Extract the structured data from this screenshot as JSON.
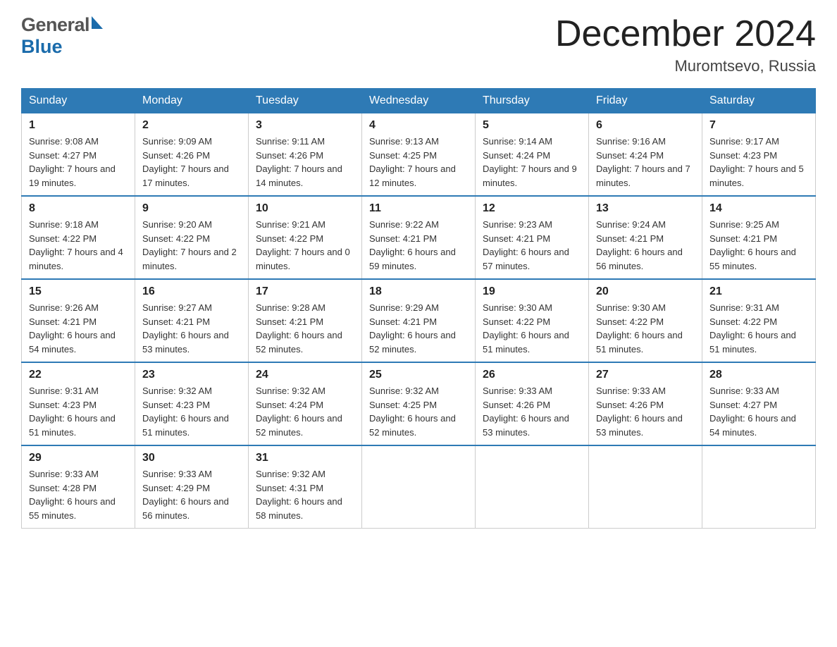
{
  "header": {
    "month_title": "December 2024",
    "location": "Muromtsevo, Russia",
    "logo_general": "General",
    "logo_blue": "Blue"
  },
  "days_of_week": [
    "Sunday",
    "Monday",
    "Tuesday",
    "Wednesday",
    "Thursday",
    "Friday",
    "Saturday"
  ],
  "weeks": [
    [
      {
        "day": "1",
        "sunrise": "9:08 AM",
        "sunset": "4:27 PM",
        "daylight": "7 hours and 19 minutes."
      },
      {
        "day": "2",
        "sunrise": "9:09 AM",
        "sunset": "4:26 PM",
        "daylight": "7 hours and 17 minutes."
      },
      {
        "day": "3",
        "sunrise": "9:11 AM",
        "sunset": "4:26 PM",
        "daylight": "7 hours and 14 minutes."
      },
      {
        "day": "4",
        "sunrise": "9:13 AM",
        "sunset": "4:25 PM",
        "daylight": "7 hours and 12 minutes."
      },
      {
        "day": "5",
        "sunrise": "9:14 AM",
        "sunset": "4:24 PM",
        "daylight": "7 hours and 9 minutes."
      },
      {
        "day": "6",
        "sunrise": "9:16 AM",
        "sunset": "4:24 PM",
        "daylight": "7 hours and 7 minutes."
      },
      {
        "day": "7",
        "sunrise": "9:17 AM",
        "sunset": "4:23 PM",
        "daylight": "7 hours and 5 minutes."
      }
    ],
    [
      {
        "day": "8",
        "sunrise": "9:18 AM",
        "sunset": "4:22 PM",
        "daylight": "7 hours and 4 minutes."
      },
      {
        "day": "9",
        "sunrise": "9:20 AM",
        "sunset": "4:22 PM",
        "daylight": "7 hours and 2 minutes."
      },
      {
        "day": "10",
        "sunrise": "9:21 AM",
        "sunset": "4:22 PM",
        "daylight": "7 hours and 0 minutes."
      },
      {
        "day": "11",
        "sunrise": "9:22 AM",
        "sunset": "4:21 PM",
        "daylight": "6 hours and 59 minutes."
      },
      {
        "day": "12",
        "sunrise": "9:23 AM",
        "sunset": "4:21 PM",
        "daylight": "6 hours and 57 minutes."
      },
      {
        "day": "13",
        "sunrise": "9:24 AM",
        "sunset": "4:21 PM",
        "daylight": "6 hours and 56 minutes."
      },
      {
        "day": "14",
        "sunrise": "9:25 AM",
        "sunset": "4:21 PM",
        "daylight": "6 hours and 55 minutes."
      }
    ],
    [
      {
        "day": "15",
        "sunrise": "9:26 AM",
        "sunset": "4:21 PM",
        "daylight": "6 hours and 54 minutes."
      },
      {
        "day": "16",
        "sunrise": "9:27 AM",
        "sunset": "4:21 PM",
        "daylight": "6 hours and 53 minutes."
      },
      {
        "day": "17",
        "sunrise": "9:28 AM",
        "sunset": "4:21 PM",
        "daylight": "6 hours and 52 minutes."
      },
      {
        "day": "18",
        "sunrise": "9:29 AM",
        "sunset": "4:21 PM",
        "daylight": "6 hours and 52 minutes."
      },
      {
        "day": "19",
        "sunrise": "9:30 AM",
        "sunset": "4:22 PM",
        "daylight": "6 hours and 51 minutes."
      },
      {
        "day": "20",
        "sunrise": "9:30 AM",
        "sunset": "4:22 PM",
        "daylight": "6 hours and 51 minutes."
      },
      {
        "day": "21",
        "sunrise": "9:31 AM",
        "sunset": "4:22 PM",
        "daylight": "6 hours and 51 minutes."
      }
    ],
    [
      {
        "day": "22",
        "sunrise": "9:31 AM",
        "sunset": "4:23 PM",
        "daylight": "6 hours and 51 minutes."
      },
      {
        "day": "23",
        "sunrise": "9:32 AM",
        "sunset": "4:23 PM",
        "daylight": "6 hours and 51 minutes."
      },
      {
        "day": "24",
        "sunrise": "9:32 AM",
        "sunset": "4:24 PM",
        "daylight": "6 hours and 52 minutes."
      },
      {
        "day": "25",
        "sunrise": "9:32 AM",
        "sunset": "4:25 PM",
        "daylight": "6 hours and 52 minutes."
      },
      {
        "day": "26",
        "sunrise": "9:33 AM",
        "sunset": "4:26 PM",
        "daylight": "6 hours and 53 minutes."
      },
      {
        "day": "27",
        "sunrise": "9:33 AM",
        "sunset": "4:26 PM",
        "daylight": "6 hours and 53 minutes."
      },
      {
        "day": "28",
        "sunrise": "9:33 AM",
        "sunset": "4:27 PM",
        "daylight": "6 hours and 54 minutes."
      }
    ],
    [
      {
        "day": "29",
        "sunrise": "9:33 AM",
        "sunset": "4:28 PM",
        "daylight": "6 hours and 55 minutes."
      },
      {
        "day": "30",
        "sunrise": "9:33 AM",
        "sunset": "4:29 PM",
        "daylight": "6 hours and 56 minutes."
      },
      {
        "day": "31",
        "sunrise": "9:32 AM",
        "sunset": "4:31 PM",
        "daylight": "6 hours and 58 minutes."
      },
      null,
      null,
      null,
      null
    ]
  ],
  "labels": {
    "sunrise": "Sunrise:",
    "sunset": "Sunset:",
    "daylight": "Daylight:"
  }
}
